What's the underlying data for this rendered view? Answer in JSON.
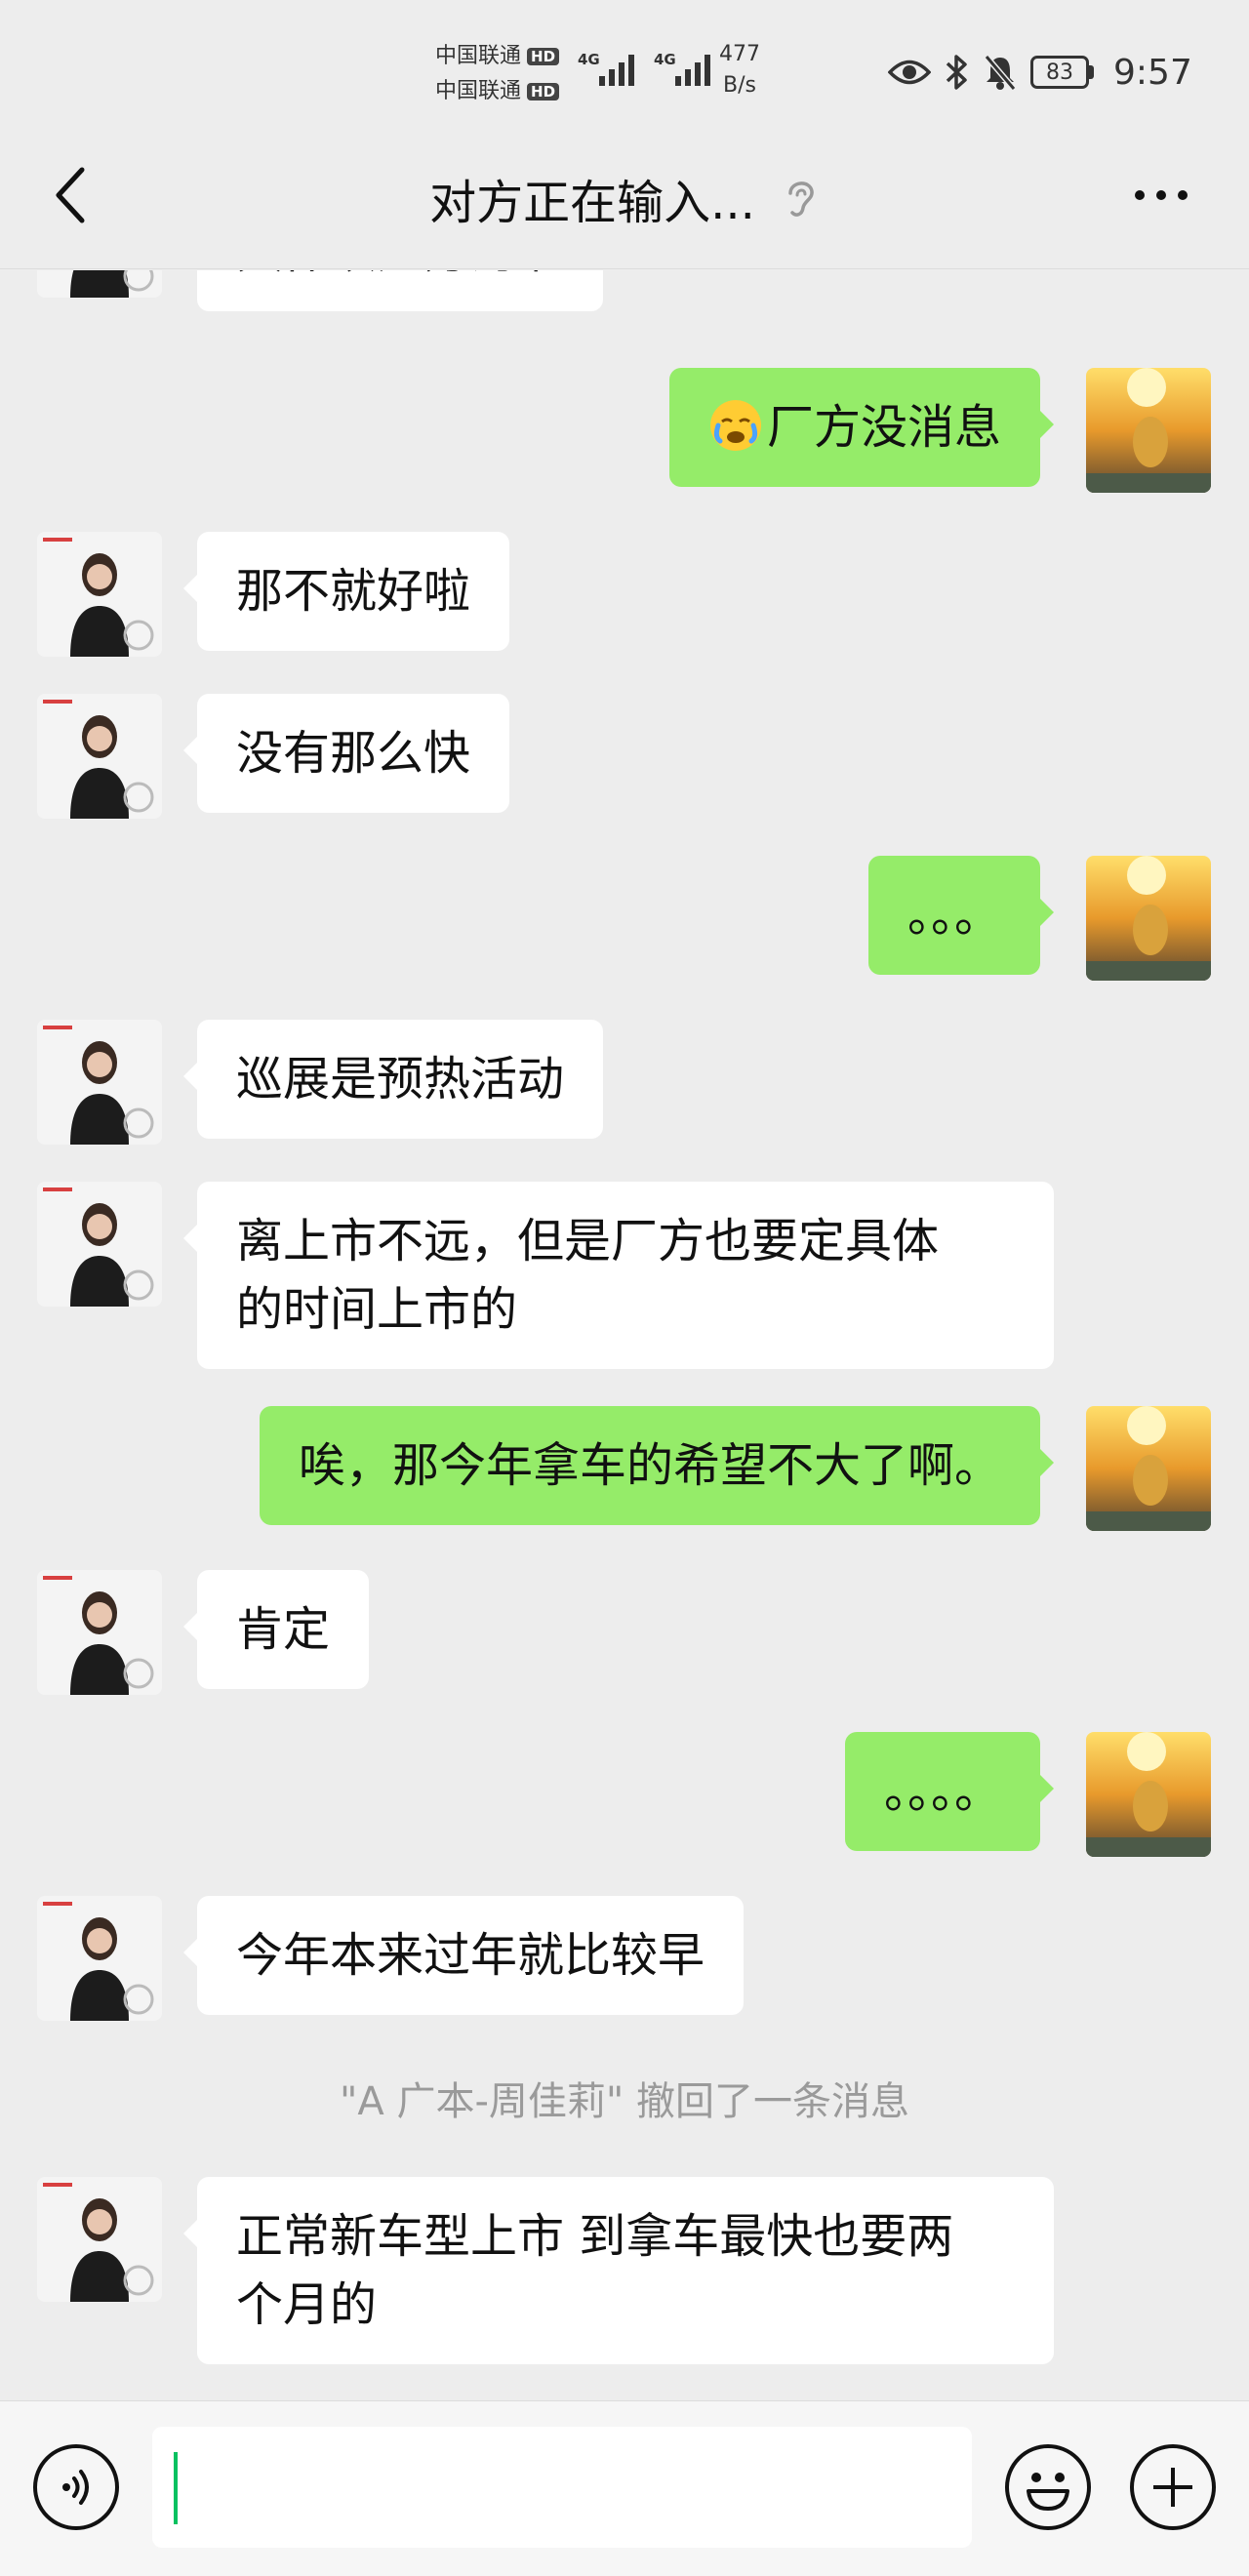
{
  "status_bar": {
    "carrier_1": "中国联通",
    "carrier_2": "中国联通",
    "hd_badge": "HD",
    "network_type": "4G",
    "speed_value": "477",
    "speed_unit": "B/s",
    "battery_level": "83",
    "time": "9:57"
  },
  "header": {
    "title": "对方正在输入..."
  },
  "messages": [
    {
      "sender": "them",
      "text": "具体以厂方为准"
    },
    {
      "sender": "me",
      "text": "厂方没消息",
      "emoji": "crying-face"
    },
    {
      "sender": "them",
      "text": "那不就好啦"
    },
    {
      "sender": "them",
      "text": "没有那么快"
    },
    {
      "sender": "me",
      "text": "。。。"
    },
    {
      "sender": "them",
      "text": "巡展是预热活动"
    },
    {
      "sender": "them",
      "text_line1": "离上市不远，但是厂方也要定具体",
      "text_line2": "的时间上市的"
    },
    {
      "sender": "me",
      "text": "唉，那今年拿车的希望不大了啊。"
    },
    {
      "sender": "them",
      "text": "肯定"
    },
    {
      "sender": "me",
      "text": "。。。。"
    },
    {
      "sender": "them",
      "text": "今年本来过年就比较早"
    },
    {
      "sender": "system",
      "text": "\"A 广本-周佳莉\" 撤回了一条消息"
    },
    {
      "sender": "them",
      "text_line1": "正常新车型上市 到拿车最快也要两",
      "text_line2": "个月的"
    }
  ],
  "input_bar": {
    "input_value": ""
  },
  "colors": {
    "background": "#ededed",
    "my_bubble": "#95ec69",
    "their_bubble": "#ffffff",
    "caret": "#07c160"
  }
}
